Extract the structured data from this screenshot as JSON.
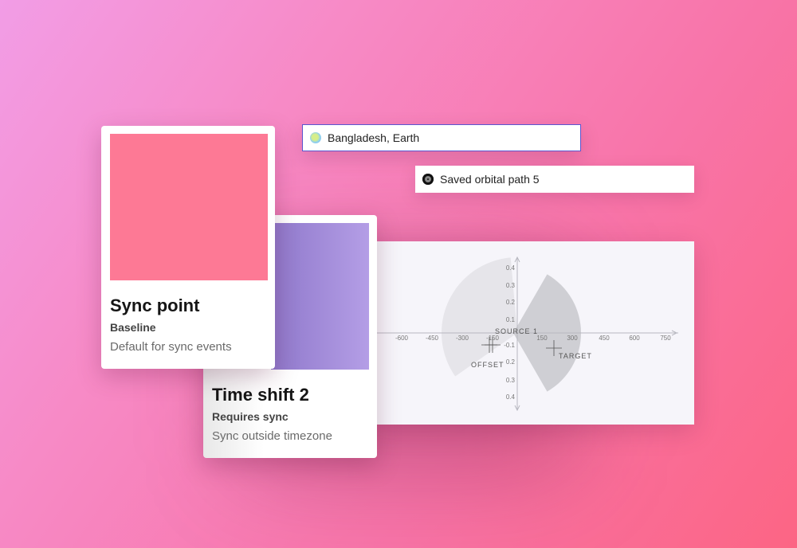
{
  "location": {
    "label": "Bangladesh, Earth",
    "icon": "globe-icon"
  },
  "orbit": {
    "label": "Saved orbital path 5",
    "icon": "radio-selected-icon"
  },
  "card_sync": {
    "title": "Sync point",
    "subtitle": "Baseline",
    "description": "Default for sync events",
    "swatch_color": "#fd7995"
  },
  "card_shift": {
    "title": "Time shift 2",
    "subtitle": "Requires sync",
    "description": "Sync outside timezone",
    "swatch_color": "#a892dc"
  },
  "chart_data": {
    "type": "scatter",
    "x_ticks": [
      "-600",
      "-450",
      "-300",
      "-150",
      "150",
      "300",
      "450",
      "600",
      "750"
    ],
    "y_ticks": [
      "0.4",
      "0.3",
      "0.2",
      "0.1",
      "-0.1",
      "0.2",
      "0.3",
      "0.4"
    ],
    "points": [
      {
        "label": "SOURCE 1"
      },
      {
        "label": "OFFSET"
      },
      {
        "label": "TARGET"
      }
    ],
    "axis_color": "#b8b8c0",
    "sector_color": "#c8c8cc"
  }
}
